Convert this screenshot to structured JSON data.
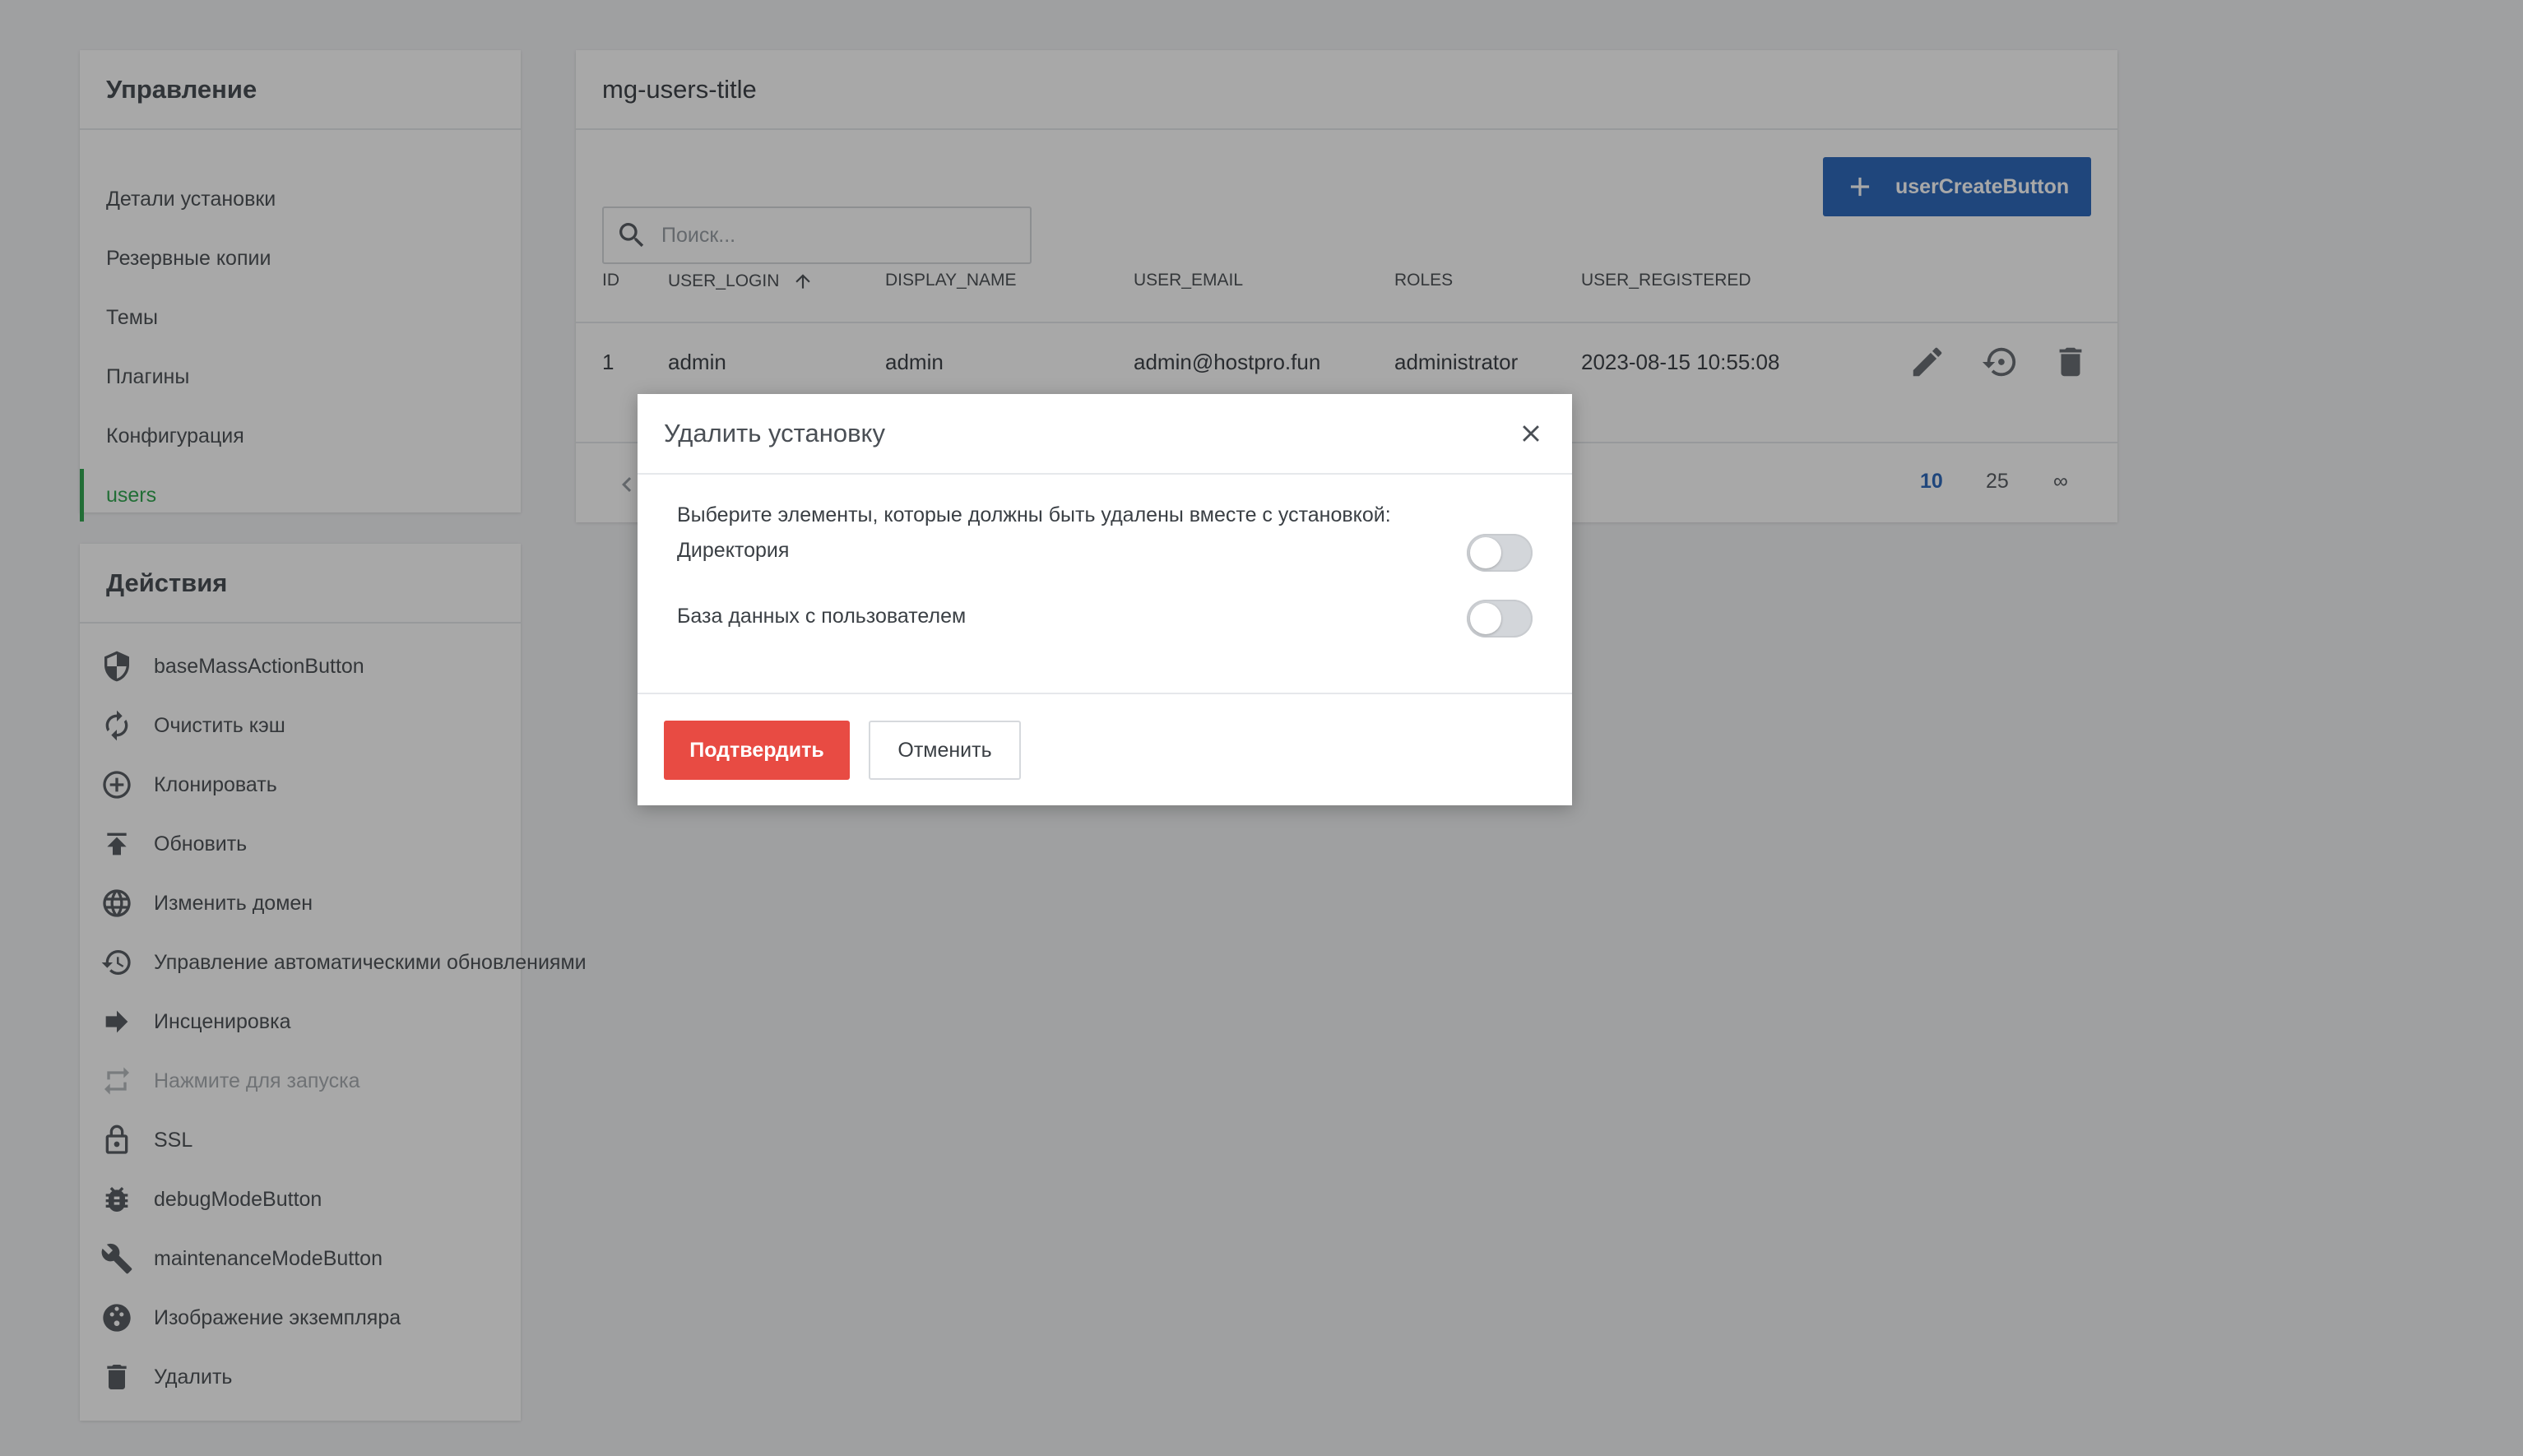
{
  "sidebar": {
    "management_title": "Управление",
    "nav_items": [
      {
        "label": "Детали установки"
      },
      {
        "label": "Резервные копии"
      },
      {
        "label": "Темы"
      },
      {
        "label": "Плагины"
      },
      {
        "label": "Конфигурация"
      },
      {
        "label": "users",
        "active": true
      }
    ],
    "actions_title": "Действия",
    "actions": [
      {
        "label": "baseMassActionButton",
        "icon": "shield-icon"
      },
      {
        "label": "Очистить кэш",
        "icon": "refresh-icon"
      },
      {
        "label": "Клонировать",
        "icon": "clone-icon"
      },
      {
        "label": "Обновить",
        "icon": "upload-icon"
      },
      {
        "label": "Изменить домен",
        "icon": "globe-icon"
      },
      {
        "label": "Управление автоматическими обновлениями",
        "icon": "history-icon"
      },
      {
        "label": "Инсценировка",
        "icon": "arrow-right-icon"
      },
      {
        "label": "Нажмите для запуска",
        "icon": "swap-icon",
        "disabled": true
      },
      {
        "label": "SSL",
        "icon": "lock-icon"
      },
      {
        "label": "debugModeButton",
        "icon": "bug-icon"
      },
      {
        "label": "maintenanceModeButton",
        "icon": "wrench-icon"
      },
      {
        "label": "Изображение экземпляра",
        "icon": "snapshot-icon"
      },
      {
        "label": "Удалить",
        "icon": "trash-icon"
      }
    ]
  },
  "main": {
    "title": "mg-users-title",
    "search_placeholder": "Поиск...",
    "create_button": "userCreateButton",
    "columns": [
      "ID",
      "USER_LOGIN",
      "DISPLAY_NAME",
      "USER_EMAIL",
      "ROLES",
      "USER_REGISTERED"
    ],
    "rows": [
      {
        "id": "1",
        "user_login": "admin",
        "display_name": "admin",
        "user_email": "admin@hostpro.fun",
        "roles": "administrator",
        "user_registered": "2023-08-15 10:55:08"
      }
    ],
    "page_sizes": [
      "10",
      "25",
      "∞"
    ],
    "active_page_size": "10"
  },
  "modal": {
    "title": "Удалить установку",
    "description": "Выберите элементы, которые должны быть удалены вместе с установкой:",
    "options": [
      {
        "label": "Директория",
        "enabled": false
      },
      {
        "label": "База данных с пользователем",
        "enabled": false
      }
    ],
    "confirm_label": "Подтвердить",
    "cancel_label": "Отменить"
  },
  "colors": {
    "accent": "#2f6bbd",
    "active_nav": "#34a853",
    "danger": "#e84b43"
  }
}
